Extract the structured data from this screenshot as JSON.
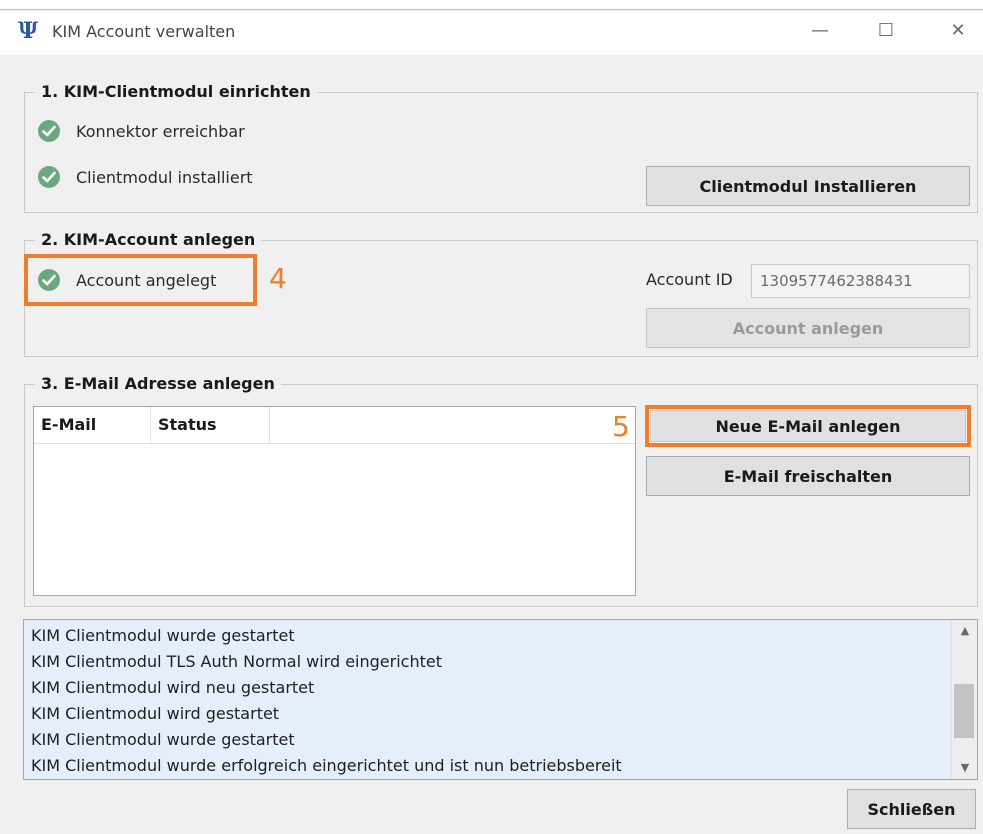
{
  "window": {
    "title": "KIM Account verwalten",
    "app_icon_glyph": "Ψ",
    "icon_names": [
      "psi-logo-icon",
      "minimize-icon",
      "maximize-icon",
      "close-icon"
    ],
    "controls": {
      "minimize": "—",
      "maximize": "☐",
      "close": "✕"
    }
  },
  "section1": {
    "title": "1. KIM-Clientmodul einrichten",
    "status_items": [
      {
        "label": "Konnektor erreichbar",
        "icon": "check-circle-icon"
      },
      {
        "label": "Clientmodul installiert",
        "icon": "check-circle-icon"
      }
    ],
    "install_button": "Clientmodul Installieren"
  },
  "section2": {
    "title": "2. KIM-Account anlegen",
    "status_label": "Account angelegt",
    "callout_number": "4",
    "account_id_label": "Account ID",
    "account_id_value": "1309577462388431",
    "create_button": "Account anlegen"
  },
  "section3": {
    "title": "3. E-Mail Adresse anlegen",
    "columns": [
      "E-Mail",
      "Status"
    ],
    "rows": [],
    "callout_number": "5",
    "new_email_button": "Neue E-Mail anlegen",
    "activate_button": "E-Mail freischalten"
  },
  "log": {
    "lines": [
      "KIM Clientmodul wurde gestartet",
      "KIM Clientmodul TLS Auth Normal wird eingerichtet",
      "KIM Clientmodul wird neu gestartet",
      "KIM Clientmodul wird gestartet",
      "KIM Clientmodul wurde gestartet",
      "KIM Clientmodul wurde erfolgreich eingerichtet und ist nun betriebsbereit"
    ]
  },
  "footer": {
    "close_button": "Schließen"
  },
  "colors": {
    "highlight": "#f07d2a",
    "check": "#6aa980",
    "log_background": "#e4effb",
    "app_icon": "#2d5c9c"
  }
}
